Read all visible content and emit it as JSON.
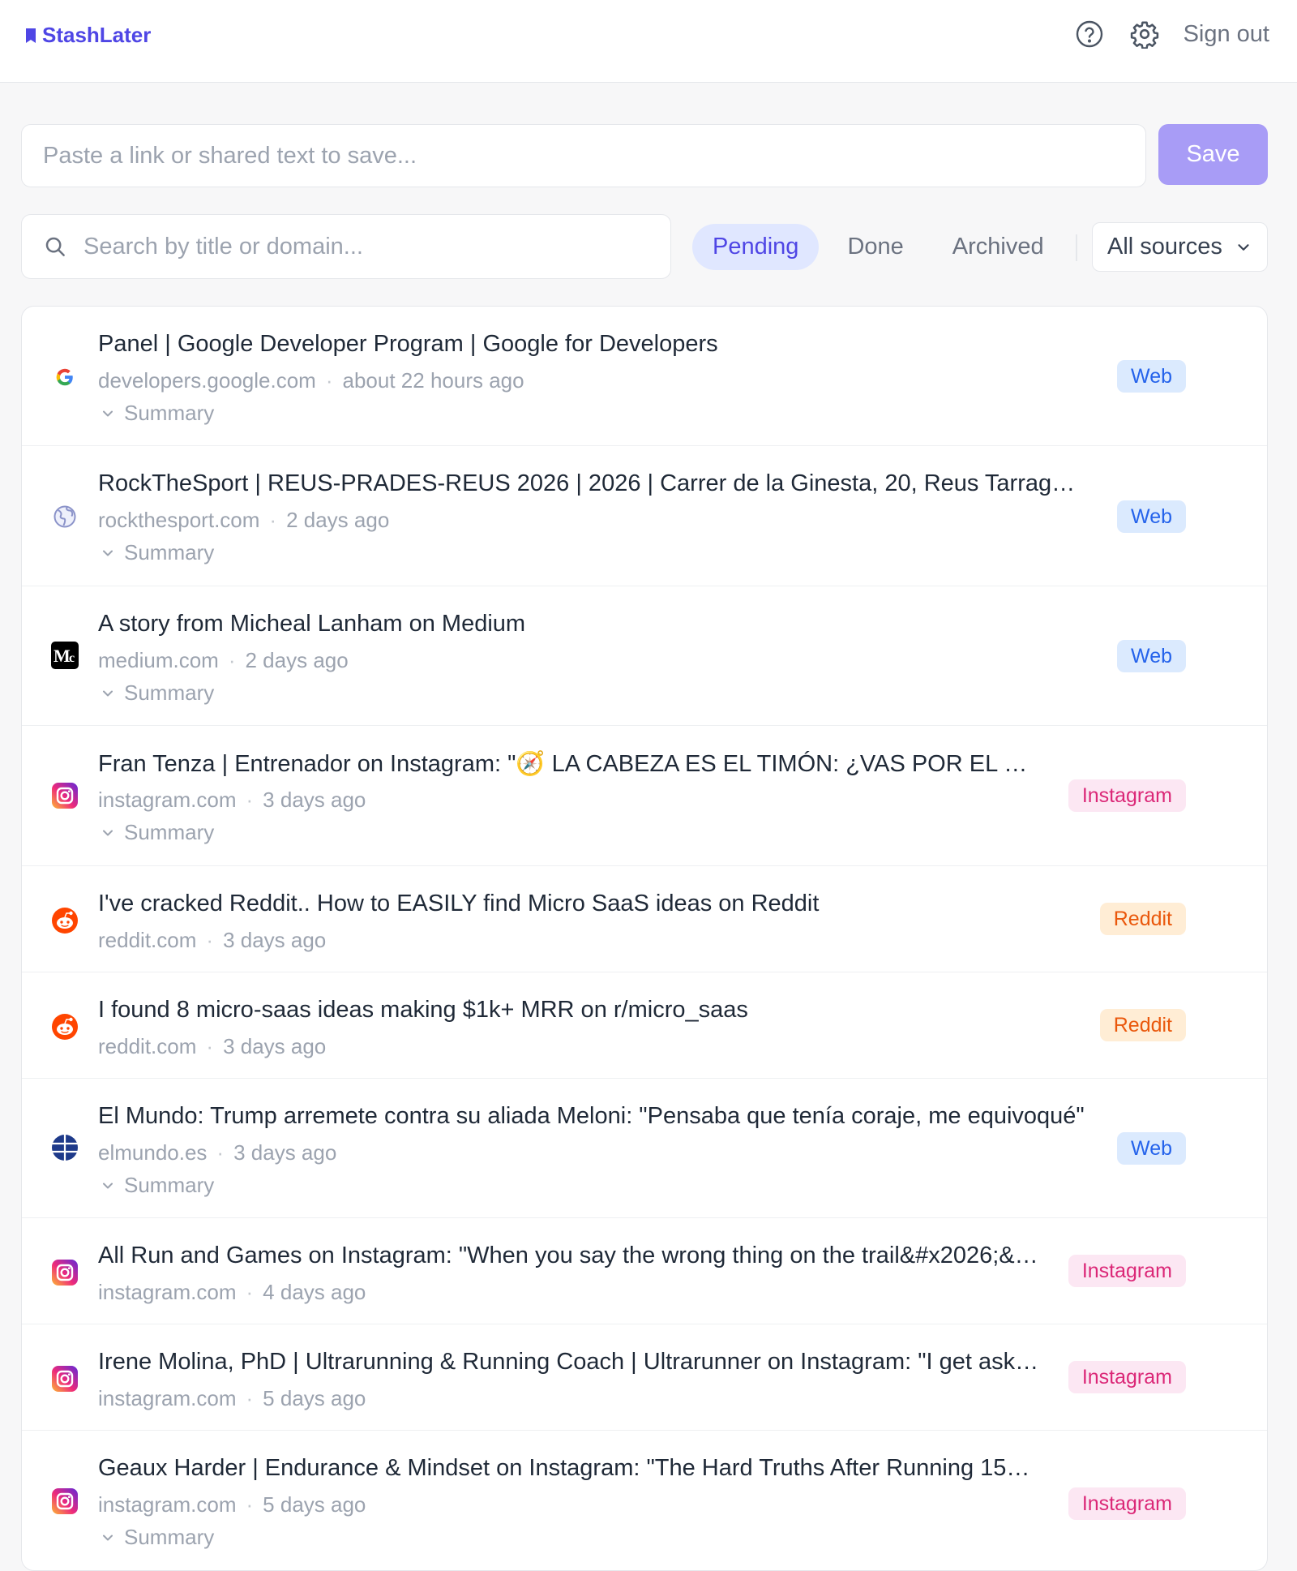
{
  "app": {
    "name": "StashLater",
    "brand_color": "#4f46e5"
  },
  "header": {
    "help_icon": "help-circle-icon",
    "settings_icon": "gear-icon",
    "sign_out_label": "Sign out"
  },
  "composer": {
    "placeholder": "Paste a link or shared text to save...",
    "value": "",
    "save_label": "Save"
  },
  "search": {
    "placeholder": "Search by title or domain...",
    "value": ""
  },
  "tabs": [
    {
      "label": "Pending",
      "active": true
    },
    {
      "label": "Done",
      "active": false
    },
    {
      "label": "Archived",
      "active": false
    }
  ],
  "source_filter": {
    "selected": "All sources"
  },
  "items": [
    {
      "title": "Panel | Google Developer Program  |  Google for Developers",
      "domain": "developers.google.com",
      "time": "about 22 hours ago",
      "summary_label": "Summary",
      "badge": "Web",
      "badge_type": "web",
      "favicon": "google-icon"
    },
    {
      "title": "RockTheSport | REUS-PRADES-REUS 2026 | 2026 | Carrer de la Ginesta, 20, Reus Tarrag…",
      "domain": "rockthesport.com",
      "time": "2 days ago",
      "summary_label": "Summary",
      "badge": "Web",
      "badge_type": "web",
      "favicon": "globe-icon"
    },
    {
      "title": "A story from Micheal Lanham on Medium",
      "domain": "medium.com",
      "time": "2 days ago",
      "summary_label": "Summary",
      "badge": "Web",
      "badge_type": "web",
      "favicon": "medium-icon"
    },
    {
      "title": "Fran Tenza | Entrenador on Instagram: \"🧭 LA CABEZA ES EL TIMÓN: ¿VAS POR EL …",
      "domain": "instagram.com",
      "time": "3 days ago",
      "summary_label": "Summary",
      "badge": "Instagram",
      "badge_type": "instagram",
      "favicon": "instagram-icon"
    },
    {
      "title": "I've cracked Reddit.. How to EASILY find Micro SaaS ideas on Reddit",
      "domain": "reddit.com",
      "time": "3 days ago",
      "summary_label": "",
      "badge": "Reddit",
      "badge_type": "reddit",
      "favicon": "reddit-icon"
    },
    {
      "title": "I found 8 micro-saas ideas making $1k+ MRR on r/micro_saas",
      "domain": "reddit.com",
      "time": "3 days ago",
      "summary_label": "",
      "badge": "Reddit",
      "badge_type": "reddit",
      "favicon": "reddit-icon"
    },
    {
      "title": "El Mundo: Trump arremete contra su aliada Meloni: \"Pensaba que tenía coraje, me equivoqué\"",
      "domain": "elmundo.es",
      "time": "3 days ago",
      "summary_label": "Summary",
      "badge": "Web",
      "badge_type": "web",
      "favicon": "elmundo-icon"
    },
    {
      "title": "All Run and Games on Instagram: \"When you say the wrong thing on the trail&#x2026;&…",
      "domain": "instagram.com",
      "time": "4 days ago",
      "summary_label": "",
      "badge": "Instagram",
      "badge_type": "instagram",
      "favicon": "instagram-icon"
    },
    {
      "title": "Irene Molina, PhD | Ultrarunning & Running Coach | Ultrarunner on Instagram: \"I get ask…",
      "domain": "instagram.com",
      "time": "5 days ago",
      "summary_label": "",
      "badge": "Instagram",
      "badge_type": "instagram",
      "favicon": "instagram-icon"
    },
    {
      "title": "Geaux Harder | Endurance & Mindset on Instagram: \"The Hard Truths After Running 15…",
      "domain": "instagram.com",
      "time": "5 days ago",
      "summary_label": "Summary",
      "badge": "Instagram",
      "badge_type": "instagram",
      "favicon": "instagram-icon"
    }
  ]
}
